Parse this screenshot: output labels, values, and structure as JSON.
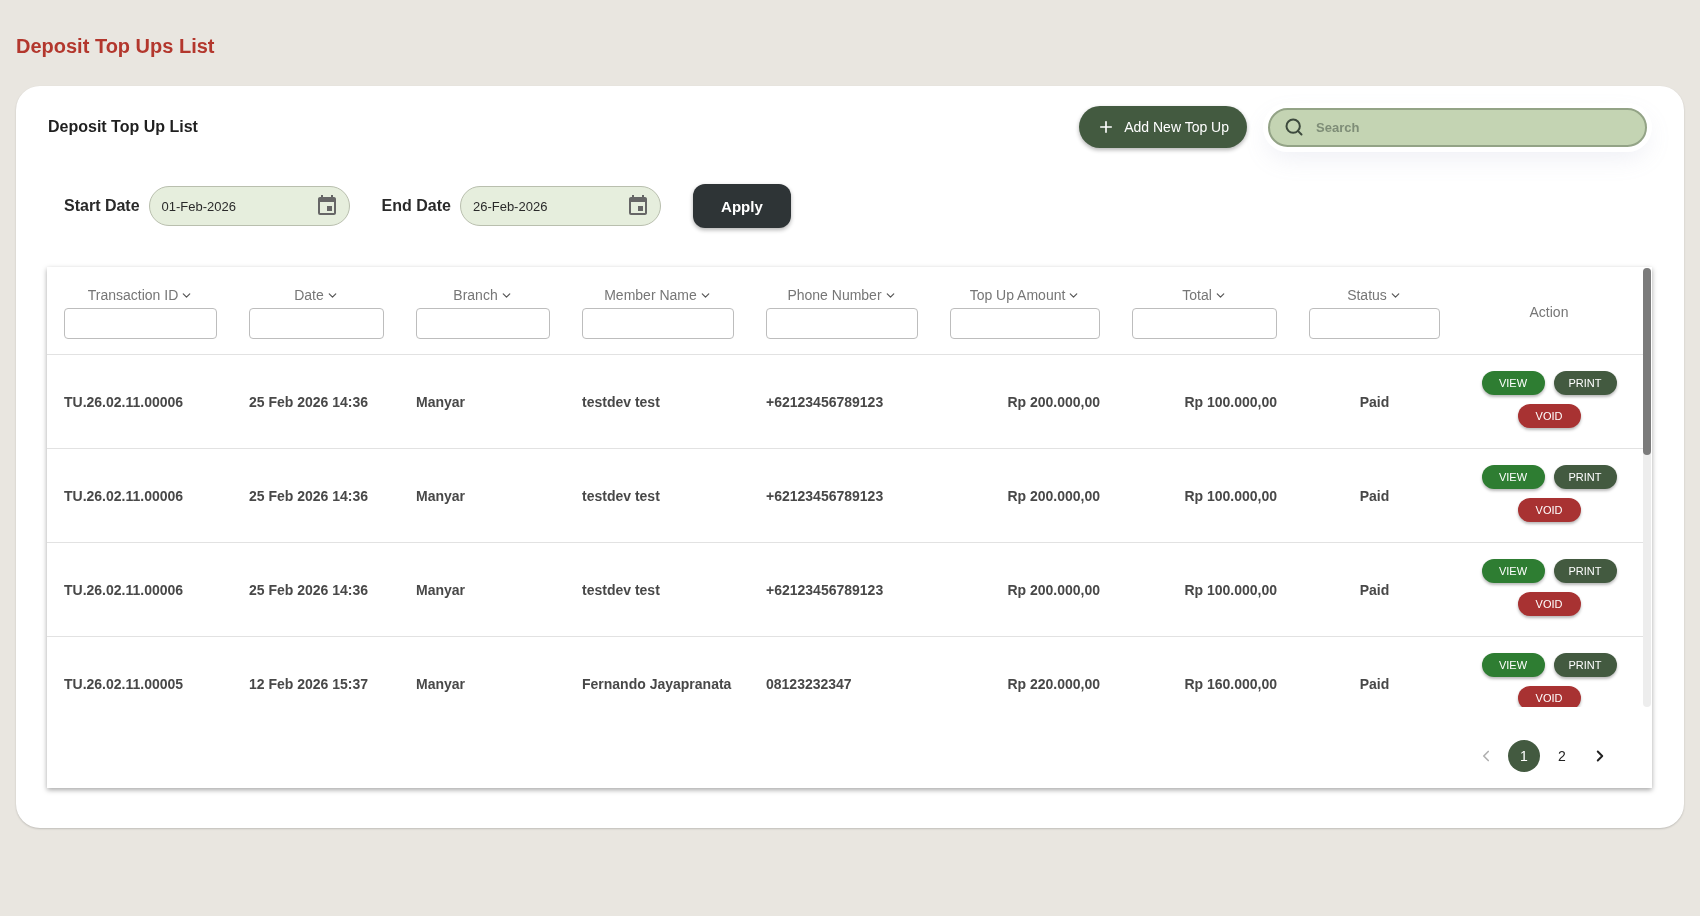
{
  "page": {
    "title": "Deposit Top Ups List"
  },
  "card": {
    "title": "Deposit Top Up List",
    "add_button": {
      "label": "Add New Top Up"
    },
    "search": {
      "placeholder": "Search"
    }
  },
  "filters": [
    {
      "label": "Start Date",
      "value": "01-Feb-2026"
    },
    {
      "label": "End Date",
      "value": "26-Feb-2026"
    }
  ],
  "apply_button": {
    "label": "Apply"
  },
  "table": {
    "columns": [
      {
        "label": "Transaction ID",
        "kind": "text",
        "sortable": true,
        "filterable": true
      },
      {
        "label": "Date",
        "kind": "text",
        "sortable": true,
        "filterable": true
      },
      {
        "label": "Branch",
        "kind": "text",
        "sortable": true,
        "filterable": true
      },
      {
        "label": "Member Name",
        "kind": "text",
        "sortable": true,
        "filterable": true
      },
      {
        "label": "Phone Number",
        "kind": "text",
        "sortable": true,
        "filterable": true
      },
      {
        "label": "Top Up Amount",
        "kind": "amount",
        "sortable": true,
        "filterable": true
      },
      {
        "label": "Total",
        "kind": "amount",
        "sortable": true,
        "filterable": true
      },
      {
        "label": "Status",
        "kind": "status",
        "sortable": true,
        "filterable": true
      },
      {
        "label": "Action",
        "kind": "actions",
        "sortable": false,
        "filterable": false
      }
    ],
    "rows": [
      {
        "cells": [
          "TU.26.02.11.00006",
          "25 Feb 2026 14:36",
          "Manyar",
          "testdev test",
          "+62123456789123",
          "Rp 200.000,00",
          "Rp 100.000,00",
          "Paid"
        ],
        "actions": [
          {
            "label": "VIEW",
            "kind": "view"
          },
          {
            "label": "PRINT",
            "kind": "print"
          },
          {
            "label": "VOID",
            "kind": "void"
          }
        ]
      },
      {
        "cells": [
          "TU.26.02.11.00006",
          "25 Feb 2026 14:36",
          "Manyar",
          "testdev test",
          "+62123456789123",
          "Rp 200.000,00",
          "Rp 100.000,00",
          "Paid"
        ],
        "actions": [
          {
            "label": "VIEW",
            "kind": "view"
          },
          {
            "label": "PRINT",
            "kind": "print"
          },
          {
            "label": "VOID",
            "kind": "void"
          }
        ]
      },
      {
        "cells": [
          "TU.26.02.11.00006",
          "25 Feb 2026 14:36",
          "Manyar",
          "testdev test",
          "+62123456789123",
          "Rp 200.000,00",
          "Rp 100.000,00",
          "Paid"
        ],
        "actions": [
          {
            "label": "VIEW",
            "kind": "view"
          },
          {
            "label": "PRINT",
            "kind": "print"
          },
          {
            "label": "VOID",
            "kind": "void"
          }
        ]
      },
      {
        "cells": [
          "TU.26.02.11.00005",
          "12 Feb 2026 15:37",
          "Manyar",
          "Fernando Jayapranata",
          "08123232347",
          "Rp 220.000,00",
          "Rp 160.000,00",
          "Paid"
        ],
        "actions": [
          {
            "label": "VIEW",
            "kind": "view"
          },
          {
            "label": "PRINT",
            "kind": "print"
          },
          {
            "label": "VOID",
            "kind": "void"
          }
        ]
      }
    ]
  },
  "pagination": {
    "prev": {
      "disabled": true
    },
    "pages": [
      {
        "label": "1",
        "selected": true
      },
      {
        "label": "2",
        "selected": false
      }
    ],
    "next": {
      "disabled": false
    }
  }
}
